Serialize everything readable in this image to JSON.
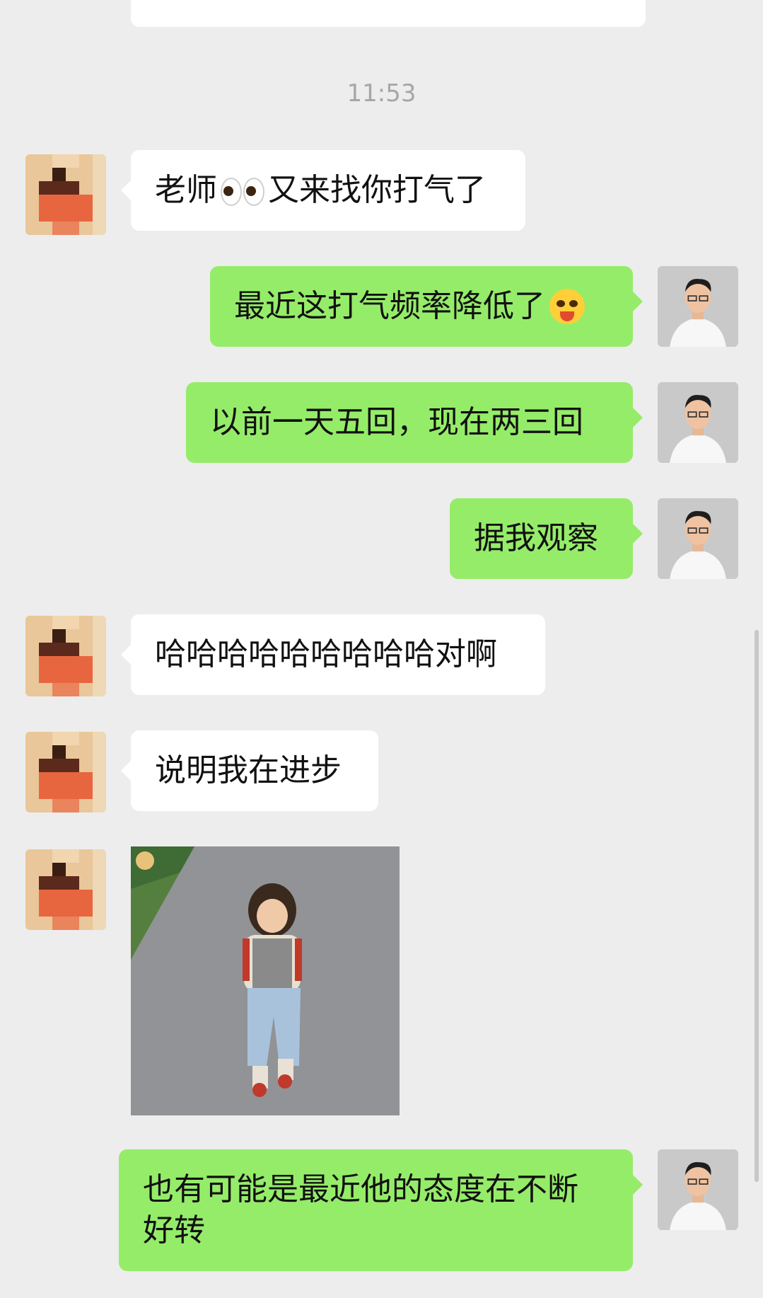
{
  "timestamp": "11:53",
  "messages": [
    {
      "side": "left",
      "text": "老师",
      "text_after": "又来找你打气了",
      "emoji": "eyes-emoji"
    },
    {
      "side": "right",
      "text": "最近这打气频率降低了",
      "emoji": "flushed-smirk-emoji"
    },
    {
      "side": "right",
      "text": "以前一天五回，现在两三回"
    },
    {
      "side": "right",
      "text": "据我观察"
    },
    {
      "side": "left",
      "text": "哈哈哈哈哈哈哈哈哈对啊"
    },
    {
      "side": "left",
      "text": "说明我在进步"
    },
    {
      "side": "left",
      "type": "sticker",
      "alt": "girl-walking-sticker"
    },
    {
      "side": "right",
      "text": "也有可能是最近他的态度在不断",
      "text_line2": "好转"
    }
  ],
  "colors": {
    "background": "#ededed",
    "left_bubble": "#ffffff",
    "right_bubble": "#95ec69",
    "timestamp": "#a6a6a6"
  }
}
